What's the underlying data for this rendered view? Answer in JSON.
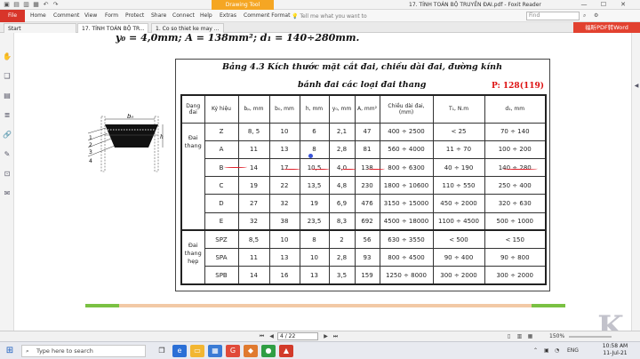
{
  "app": {
    "window_title": "17. TÍNH TOÁN BỘ TRUYỀN ĐAI.pdf - Foxit Reader",
    "drawing_tool": "Drawing Tool"
  },
  "ribbon": {
    "file": "File",
    "tabs": [
      "Home",
      "Comment",
      "View",
      "Form",
      "Protect",
      "Share",
      "Connect",
      "Help",
      "Extras",
      "Comment Format"
    ],
    "tell_me": "Tell me what you want to",
    "find_placeholder": "Find"
  },
  "doc_tabs": [
    {
      "label": "Start"
    },
    {
      "label": "17. TÍNH TOÁN BỘ TR..."
    },
    {
      "label": "1. Co so thiet ke may ..."
    }
  ],
  "convert_banner": "福昕PDF转Word",
  "document": {
    "formula": "y₀ = 4,0mm;  A = 138mm²;  d₁ = 140÷280mm.",
    "table_title_1": "Bảng 4.3  Kích thước mặt cắt đai, chiều dài đai, đường kính",
    "table_title_2": "bánh đai các loại đai thang",
    "page_ref": "P: 128(119)",
    "diagram": {
      "labels": [
        "1",
        "2",
        "3",
        "4"
      ],
      "top_label": "b₀",
      "side_label": "h",
      "inner_label": "b"
    },
    "headers": [
      "Dạng đai",
      "Ký hiệu",
      "bₚ, mm",
      "b₀, mm",
      "h, mm",
      "y₀, mm",
      "A, mm²",
      "Chiều dài đai, (mm)",
      "T₁, N.m",
      "d₁, mm"
    ],
    "groups": [
      {
        "name": "Đai thang",
        "rows": [
          [
            "Z",
            "8, 5",
            "10",
            "6",
            "2,1",
            "47",
            "400 ÷ 2500",
            "< 25",
            "70 ÷ 140"
          ],
          [
            "A",
            "11",
            "13",
            "8",
            "2,8",
            "81",
            "560 ÷ 4000",
            "11 ÷ 70",
            "100 ÷ 200"
          ],
          [
            "B",
            "14",
            "17",
            "10,5",
            "4,0",
            "138",
            "800 ÷ 6300",
            "40 ÷ 190",
            "140 ÷ 280"
          ],
          [
            "C",
            "19",
            "22",
            "13,5",
            "4,8",
            "230",
            "1800 ÷ 10600",
            "110 ÷ 550",
            "250 ÷ 400"
          ],
          [
            "D",
            "27",
            "32",
            "19",
            "6,9",
            "476",
            "3150 ÷ 15000",
            "450 ÷ 2000",
            "320 ÷ 630"
          ],
          [
            "E",
            "32",
            "38",
            "23,5",
            "8,3",
            "692",
            "4500 ÷ 18000",
            "1100 ÷ 4500",
            "500 ÷ 1000"
          ]
        ]
      },
      {
        "name": "Đai thang hẹp",
        "rows": [
          [
            "SPZ",
            "8,5",
            "10",
            "8",
            "2",
            "56",
            "630 ÷ 3550",
            "< 500",
            "< 150"
          ],
          [
            "SPA",
            "11",
            "13",
            "10",
            "2,8",
            "93",
            "800 ÷ 4500",
            "90 ÷ 400",
            "90 ÷ 800"
          ],
          [
            "SPB",
            "14",
            "16",
            "13",
            "3,5",
            "159",
            "1250 ÷ 8000",
            "300 ÷ 2000",
            "300 ÷ 2000"
          ]
        ]
      }
    ]
  },
  "status": {
    "page": "4 / 22",
    "zoom": "150%"
  },
  "taskbar": {
    "search": "Type here to search",
    "time": "10:58 AM",
    "date": "11-Jul-21",
    "lang": "ENG"
  }
}
